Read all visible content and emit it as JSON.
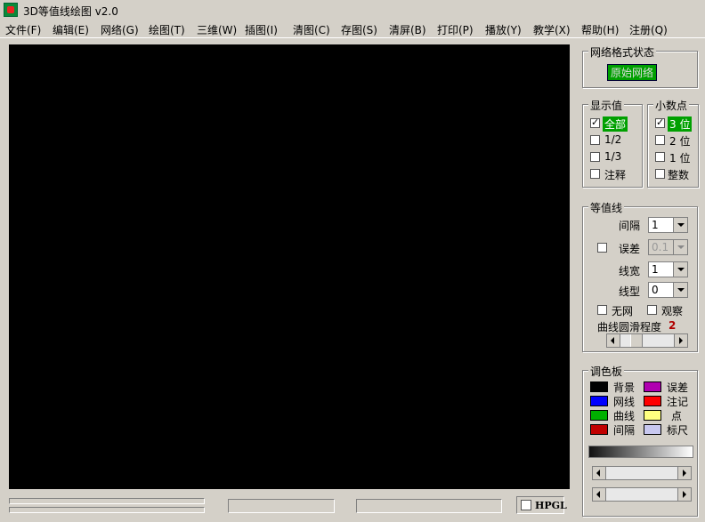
{
  "window": {
    "title": "3D等值线绘图 v2.0"
  },
  "menu": [
    "文件(F)",
    "编辑(E)",
    "网络(G)",
    "绘图(T)",
    "三维(W)",
    "插图(I)",
    "清图(C)",
    "存图(S)",
    "清屏(B)",
    "打印(P)",
    "播放(Y)",
    "教学(X)",
    "帮助(H)",
    "注册(Q)"
  ],
  "grid_status": {
    "title": "网络格式状态",
    "value": "原始网络"
  },
  "display_values": {
    "title": "显示值",
    "options": [
      {
        "label": "全部",
        "checked": true
      },
      {
        "label": "1/2",
        "checked": false
      },
      {
        "label": "1/3",
        "checked": false
      },
      {
        "label": "注释",
        "checked": false
      }
    ]
  },
  "decimals": {
    "title": "小数点",
    "options": [
      {
        "label": "3 位",
        "checked": true
      },
      {
        "label": "2 位",
        "checked": false
      },
      {
        "label": "1 位",
        "checked": false
      },
      {
        "label": "整数",
        "checked": false
      }
    ]
  },
  "contours": {
    "title": "等值线",
    "interval_label": "间隔",
    "interval_value": "1",
    "error_label": "误差",
    "error_value": "0.1",
    "line_width_label": "线宽",
    "line_width_value": "1",
    "line_type_label": "线型",
    "line_type_value": "0",
    "no_grid_label": "无网",
    "observe_label": "观察",
    "smooth_label": "曲线圆滑程度",
    "smooth_value": "2"
  },
  "palette": {
    "title": "调色板",
    "items": [
      {
        "label": "背景",
        "color": "#000000"
      },
      {
        "label": "误差",
        "color": "#b000b0"
      },
      {
        "label": "网线",
        "color": "#0000ff"
      },
      {
        "label": "注记",
        "color": "#ff0000"
      },
      {
        "label": "曲线",
        "color": "#00b000"
      },
      {
        "label": "点",
        "color": "#ffff80"
      },
      {
        "label": "间隔",
        "color": "#c00000"
      },
      {
        "label": "标尺",
        "color": "#c8c8f0"
      }
    ]
  },
  "bottom": {
    "hpgl_label": "HPGL"
  }
}
